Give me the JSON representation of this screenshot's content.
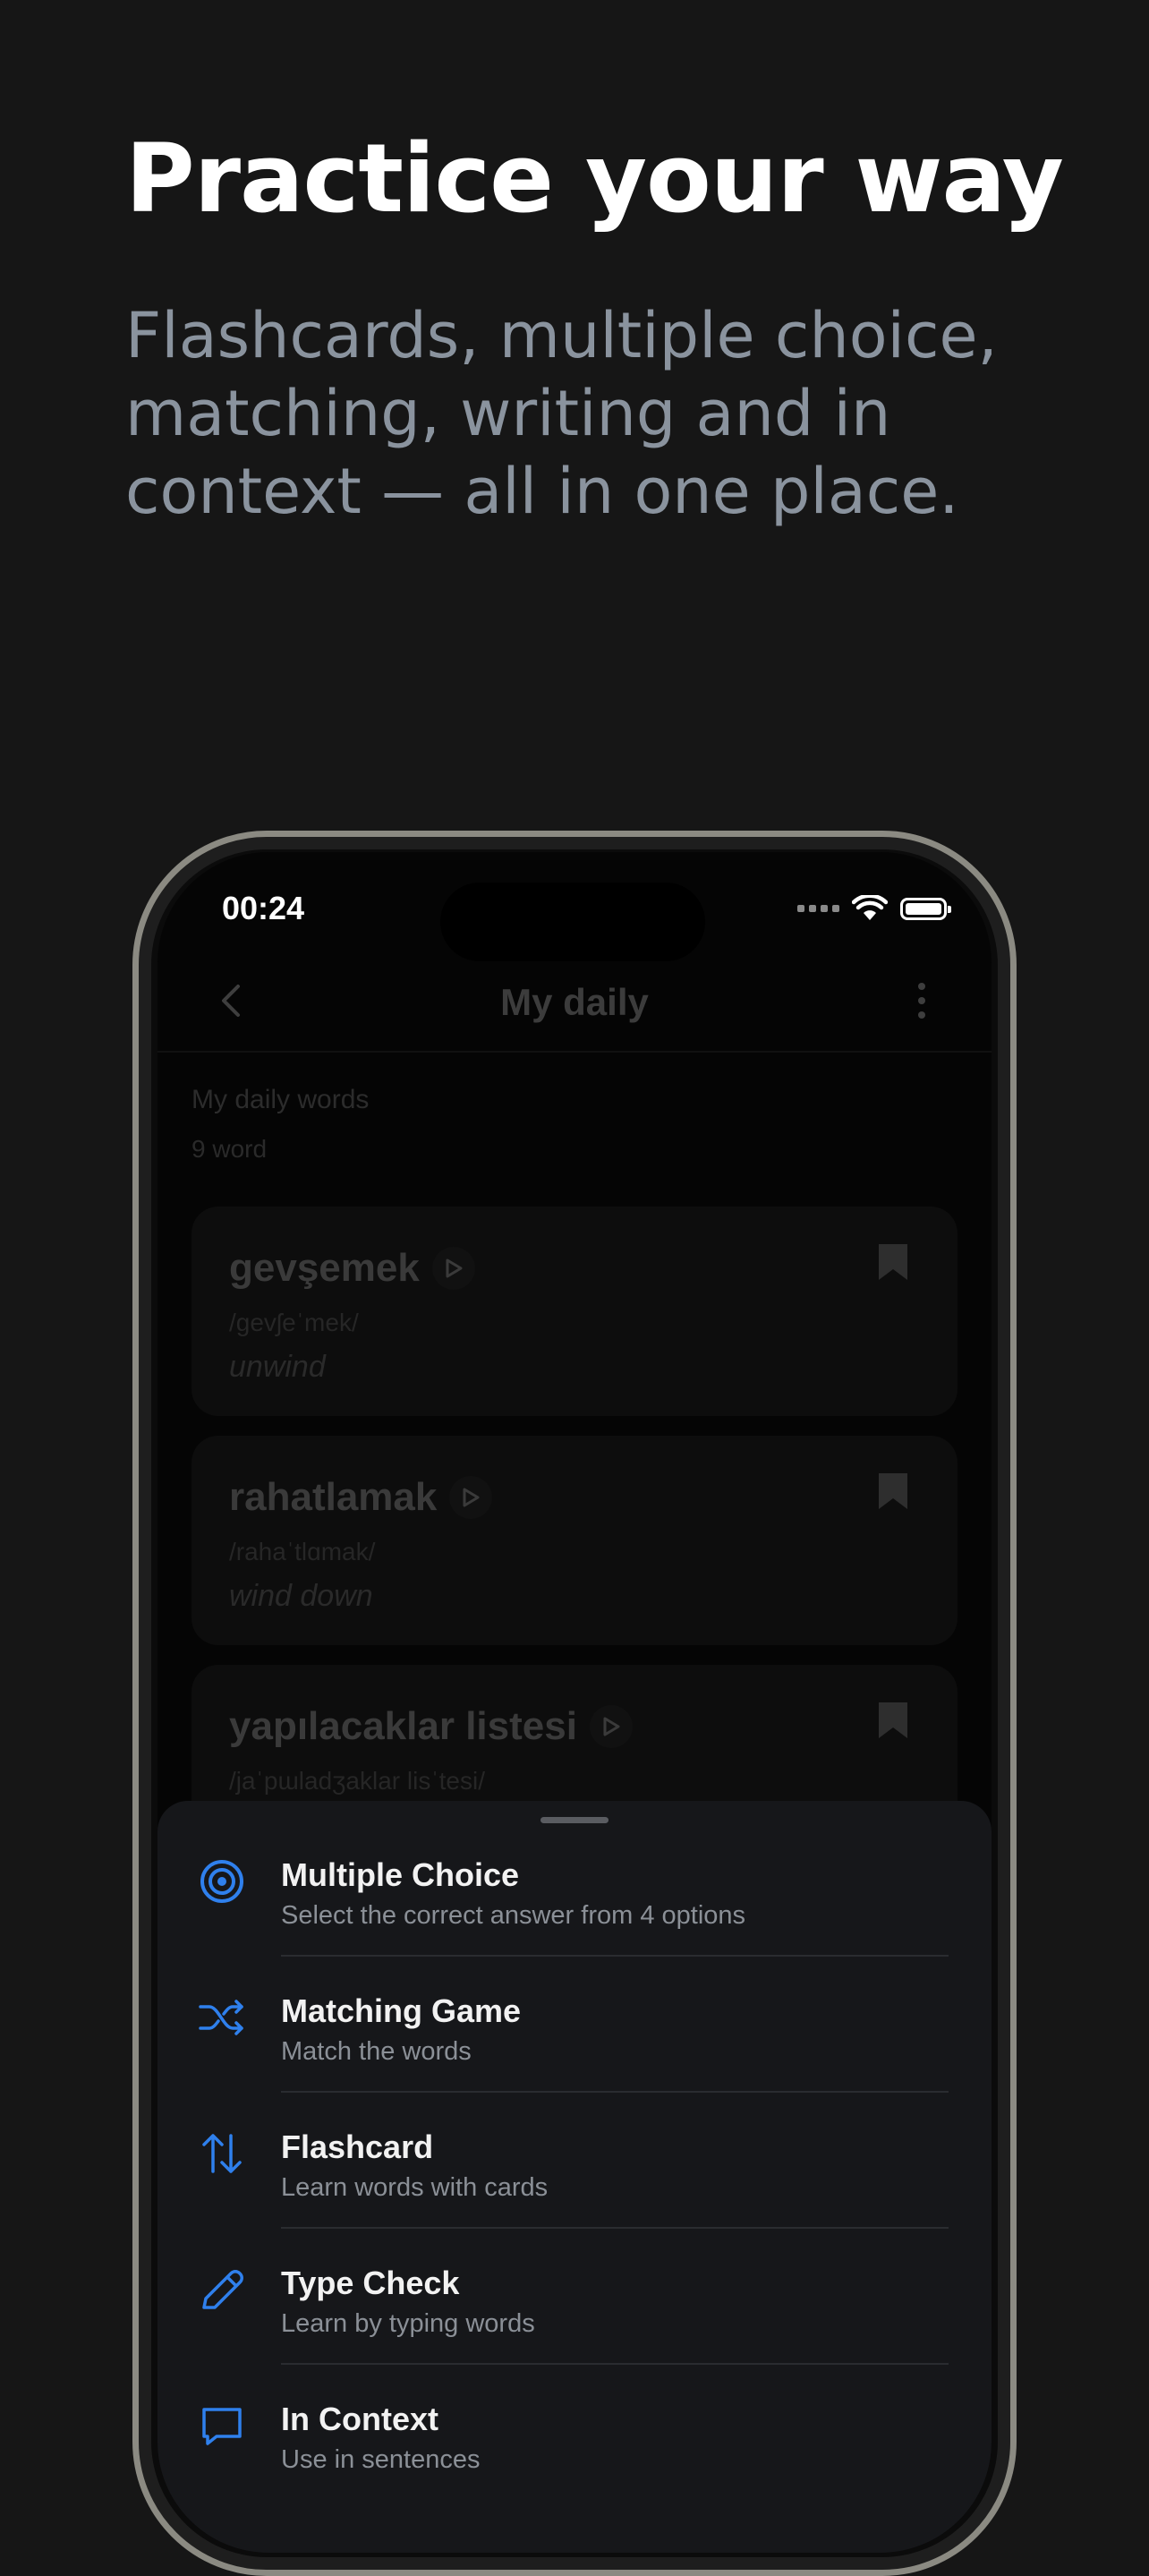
{
  "promo": {
    "headline": "Practice your way",
    "subhead": "Flashcards, multiple choice, matching, writing and in context — all in one place."
  },
  "status_bar": {
    "time": "00:24"
  },
  "nav": {
    "title": "My daily"
  },
  "list": {
    "title": "My daily words",
    "count": "9 word",
    "words": [
      {
        "term": "gevşemek",
        "ipa": "/gevʃeˈmek/",
        "translation": "unwind"
      },
      {
        "term": "rahatlamak",
        "ipa": "/rahaˈtlɑmak/",
        "translation": "wind down"
      },
      {
        "term": "yapılacaklar listesi",
        "ipa": "/jaˈpɯladʒaklar lisˈtesi/",
        "translation": ""
      }
    ]
  },
  "practice_modes": [
    {
      "label": "Multiple Choice",
      "description": "Select the correct answer from 4 options",
      "icon": "target-icon"
    },
    {
      "label": "Matching Game",
      "description": "Match the words",
      "icon": "shuffle-icon"
    },
    {
      "label": "Flashcard",
      "description": "Learn words with cards",
      "icon": "swap-vertical-icon"
    },
    {
      "label": "Type Check",
      "description": "Learn by typing words",
      "icon": "pencil-icon"
    },
    {
      "label": "In Context",
      "description": "Use in sentences",
      "icon": "chat-bubble-icon"
    }
  ],
  "colors": {
    "background": "#161616",
    "accent": "#2f80ed",
    "sheet": "#16171a",
    "text_primary": "#ffffff",
    "text_secondary": "#8a939e"
  }
}
